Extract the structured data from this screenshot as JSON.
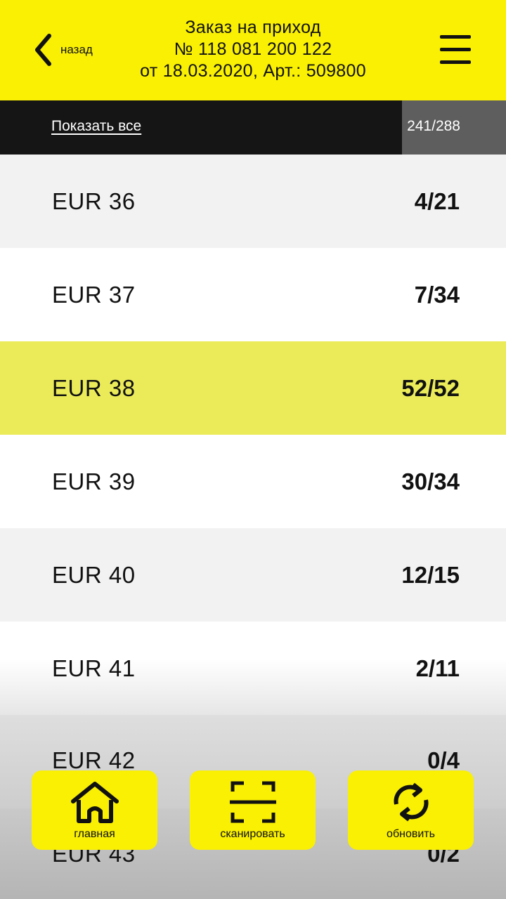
{
  "header": {
    "back_label": "назад",
    "title_line1": "Заказ на приход",
    "title_line2": "№ 118 081 200 122",
    "title_line3": "от 18.03.2020, Арт.: 509800"
  },
  "filter": {
    "show_all_label": "Показать все",
    "total_count": "241/288"
  },
  "rows": [
    {
      "size": "EUR 36",
      "count": "4/21"
    },
    {
      "size": "EUR 37",
      "count": "7/34"
    },
    {
      "size": "EUR 38",
      "count": "52/52"
    },
    {
      "size": "EUR 39",
      "count": "30/34"
    },
    {
      "size": "EUR 40",
      "count": "12/15"
    },
    {
      "size": "EUR 41",
      "count": "2/11"
    },
    {
      "size": "EUR 42",
      "count": "0/4"
    },
    {
      "size": "EUR 43",
      "count": "0/2"
    }
  ],
  "bottom_nav": {
    "home_label": "главная",
    "scan_label": "сканировать",
    "refresh_label": "обновить"
  },
  "colors": {
    "brand_yellow": "#f9f003",
    "highlight_row": "#ebeb5a",
    "filter_bar": "#151515",
    "total_box": "#5e5e5e"
  },
  "icons": {
    "back": "chevron-left-icon",
    "menu": "hamburger-menu-icon",
    "home": "home-icon",
    "scan": "scan-frame-icon",
    "refresh": "refresh-arrows-icon"
  }
}
